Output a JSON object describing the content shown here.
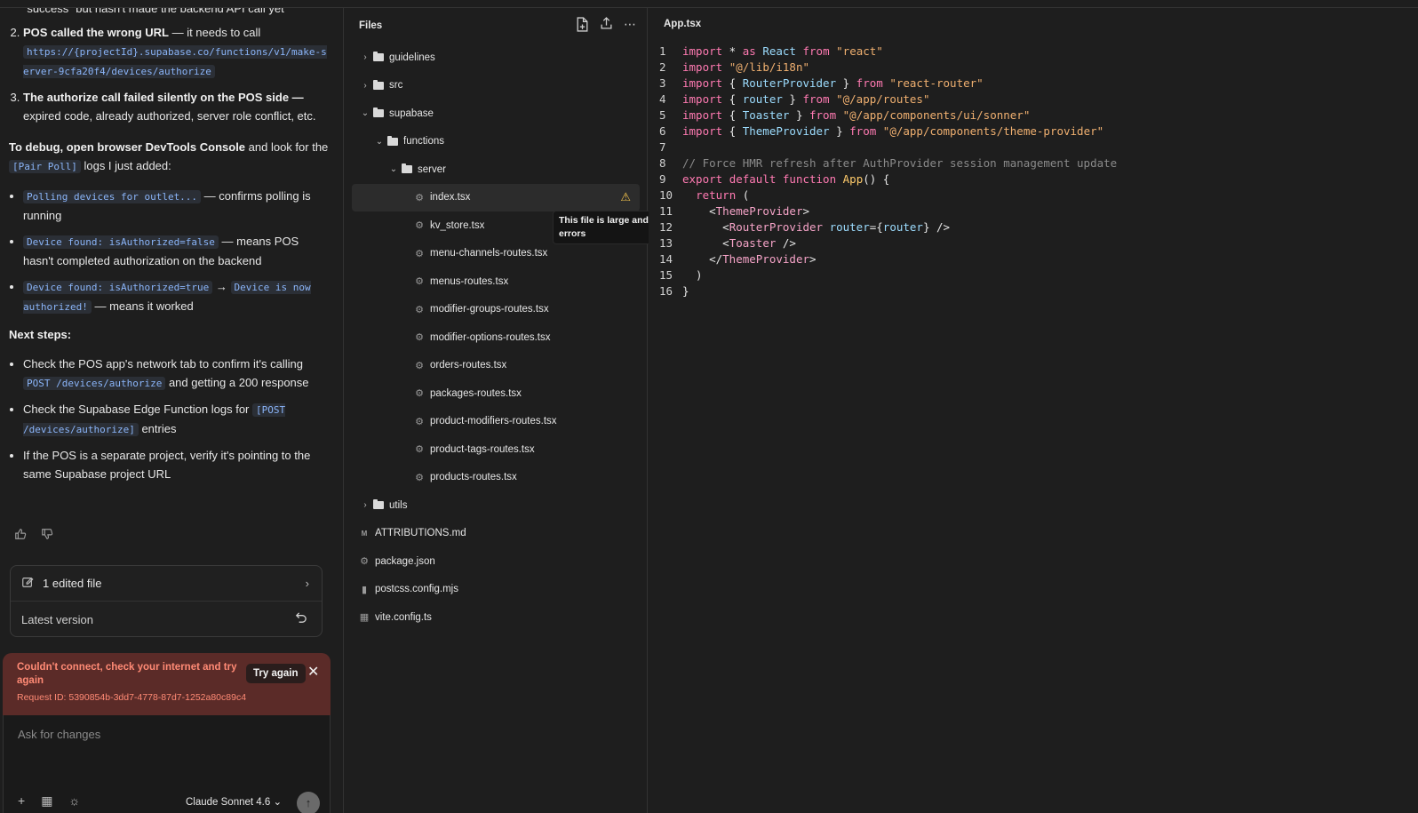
{
  "chat": {
    "partial_top": "“success” but hasn't made the backend API call yet",
    "item2_bold": "POS called the wrong URL",
    "item2_rest": " — it needs to call",
    "item2_code": "https://{projectId}.supabase.co/functions/v1/make-server-9cfa20f4/devices/authorize",
    "item3_bold": "The authorize call failed silently on the POS side —",
    "item3_rest": "expired code, already authorized, server role conflict, etc.",
    "debug_bold": "To debug, open browser DevTools Console",
    "debug_rest1": " and look for the ",
    "debug_code": "[Pair Poll]",
    "debug_rest2": " logs I just added:",
    "b1_code": "Polling devices for outlet...",
    "b1_rest": " — confirms polling is running",
    "b2_code": "Device found: isAuthorized=false",
    "b2_rest": " — means POS hasn't completed authorization on the backend",
    "b3_code1": "Device found: isAuthorized=true",
    "b3_arrow": " → ",
    "b3_code2": "Device is now authorized!",
    "b3_rest": " — means it worked",
    "next_steps": "Next steps:",
    "n1_a": "Check the POS app's network tab to confirm it's calling ",
    "n1_code": "POST /devices/authorize",
    "n1_b": " and getting a 200 response",
    "n2_a": "Check the Supabase Edge Function logs for ",
    "n2_code": "[POST /devices/authorize]",
    "n2_b": " entries",
    "n3": "If the POS is a separate project, verify it's pointing to the same Supabase project URL",
    "edited_files": "1 edited file",
    "latest_version": "Latest version",
    "error_msg": "Couldn't connect, check your internet and try again",
    "try_again": "Try again",
    "request_id": "Request ID: 5390854b-3dd7-4778-87d7-1252a80c89c4",
    "input_placeholder": "Ask for changes",
    "model": "Claude Sonnet 4.6"
  },
  "files": {
    "title": "Files",
    "tree": [
      {
        "label": "guidelines",
        "type": "folder",
        "depth": 0,
        "open": false
      },
      {
        "label": "src",
        "type": "folder",
        "depth": 0,
        "open": false
      },
      {
        "label": "supabase",
        "type": "folder",
        "depth": 0,
        "open": true
      },
      {
        "label": "functions",
        "type": "folder",
        "depth": 1,
        "open": true
      },
      {
        "label": "server",
        "type": "folder",
        "depth": 2,
        "open": true
      },
      {
        "label": "index.tsx",
        "type": "file",
        "depth": 3,
        "selected": true,
        "warning": true
      },
      {
        "label": "kv_store.tsx",
        "type": "file",
        "depth": 3
      },
      {
        "label": "menu-channels-routes.tsx",
        "type": "file",
        "depth": 3
      },
      {
        "label": "menus-routes.tsx",
        "type": "file",
        "depth": 3
      },
      {
        "label": "modifier-groups-routes.tsx",
        "type": "file",
        "depth": 3
      },
      {
        "label": "modifier-options-routes.tsx",
        "type": "file",
        "depth": 3
      },
      {
        "label": "orders-routes.tsx",
        "type": "file",
        "depth": 3
      },
      {
        "label": "packages-routes.tsx",
        "type": "file",
        "depth": 3
      },
      {
        "label": "product-modifiers-routes.tsx",
        "type": "file",
        "depth": 3
      },
      {
        "label": "product-tags-routes.tsx",
        "type": "file",
        "depth": 3
      },
      {
        "label": "products-routes.tsx",
        "type": "file",
        "depth": 3
      },
      {
        "label": "utils",
        "type": "folder",
        "depth": 0,
        "open": false
      },
      {
        "label": "ATTRIBUTIONS.md",
        "type": "md",
        "depth": -1
      },
      {
        "label": "package.json",
        "type": "json",
        "depth": -1
      },
      {
        "label": "postcss.config.mjs",
        "type": "doc",
        "depth": -1
      },
      {
        "label": "vite.config.ts",
        "type": "ts",
        "depth": -1
      }
    ],
    "tooltip": "This file is large and may cause errors"
  },
  "editor": {
    "filename": "App.tsx",
    "lines": [
      {
        "n": "1",
        "segs": [
          [
            "kw",
            "import"
          ],
          [
            "plain",
            " * "
          ],
          [
            "kw",
            "as"
          ],
          [
            "plain",
            " "
          ],
          [
            "var",
            "React"
          ],
          [
            "plain",
            " "
          ],
          [
            "kw",
            "from"
          ],
          [
            "plain",
            " "
          ],
          [
            "str",
            "\"react\""
          ]
        ]
      },
      {
        "n": "2",
        "segs": [
          [
            "kw",
            "import"
          ],
          [
            "plain",
            " "
          ],
          [
            "str",
            "\"@/lib/i18n\""
          ]
        ]
      },
      {
        "n": "3",
        "segs": [
          [
            "kw",
            "import"
          ],
          [
            "plain",
            " { "
          ],
          [
            "var",
            "RouterProvider"
          ],
          [
            "plain",
            " } "
          ],
          [
            "kw",
            "from"
          ],
          [
            "plain",
            " "
          ],
          [
            "str",
            "\"react-router\""
          ]
        ]
      },
      {
        "n": "4",
        "segs": [
          [
            "kw",
            "import"
          ],
          [
            "plain",
            " { "
          ],
          [
            "var",
            "router"
          ],
          [
            "plain",
            " } "
          ],
          [
            "kw",
            "from"
          ],
          [
            "plain",
            " "
          ],
          [
            "str",
            "\"@/app/routes\""
          ]
        ]
      },
      {
        "n": "5",
        "segs": [
          [
            "kw",
            "import"
          ],
          [
            "plain",
            " { "
          ],
          [
            "var",
            "Toaster"
          ],
          [
            "plain",
            " } "
          ],
          [
            "kw",
            "from"
          ],
          [
            "plain",
            " "
          ],
          [
            "str",
            "\"@/app/components/ui/sonner\""
          ]
        ]
      },
      {
        "n": "6",
        "segs": [
          [
            "kw",
            "import"
          ],
          [
            "plain",
            " { "
          ],
          [
            "var",
            "ThemeProvider"
          ],
          [
            "plain",
            " } "
          ],
          [
            "kw",
            "from"
          ],
          [
            "plain",
            " "
          ],
          [
            "str",
            "\"@/app/components/theme-provider\""
          ]
        ]
      },
      {
        "n": "7",
        "segs": []
      },
      {
        "n": "8",
        "segs": [
          [
            "cmt",
            "// Force HMR refresh after AuthProvider session management update"
          ]
        ]
      },
      {
        "n": "9",
        "segs": [
          [
            "kw",
            "export"
          ],
          [
            "plain",
            " "
          ],
          [
            "kw",
            "default"
          ],
          [
            "plain",
            " "
          ],
          [
            "kw",
            "function"
          ],
          [
            "plain",
            " "
          ],
          [
            "fn",
            "App"
          ],
          [
            "plain",
            "() {"
          ]
        ]
      },
      {
        "n": "10",
        "segs": [
          [
            "plain",
            "  "
          ],
          [
            "kw",
            "return"
          ],
          [
            "plain",
            " ("
          ]
        ]
      },
      {
        "n": "11",
        "segs": [
          [
            "plain",
            "    <"
          ],
          [
            "tag",
            "ThemeProvider"
          ],
          [
            "plain",
            ">"
          ]
        ]
      },
      {
        "n": "12",
        "segs": [
          [
            "plain",
            "      <"
          ],
          [
            "tag",
            "RouterProvider"
          ],
          [
            "plain",
            " "
          ],
          [
            "attr",
            "router"
          ],
          [
            "plain",
            "={"
          ],
          [
            "var",
            "router"
          ],
          [
            "plain",
            "} />"
          ]
        ]
      },
      {
        "n": "13",
        "segs": [
          [
            "plain",
            "      <"
          ],
          [
            "tag",
            "Toaster"
          ],
          [
            "plain",
            " />"
          ]
        ]
      },
      {
        "n": "14",
        "segs": [
          [
            "plain",
            "    </"
          ],
          [
            "tag",
            "ThemeProvider"
          ],
          [
            "plain",
            ">"
          ]
        ]
      },
      {
        "n": "15",
        "segs": [
          [
            "plain",
            "  )"
          ]
        ]
      },
      {
        "n": "16",
        "segs": [
          [
            "plain",
            "}"
          ]
        ]
      }
    ]
  }
}
